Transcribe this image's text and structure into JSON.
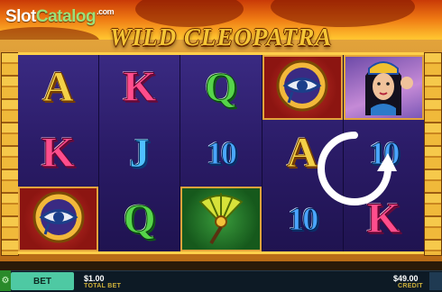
{
  "watermark": {
    "part1": "Slot",
    "part2": "Catalog",
    "suffix": ".com"
  },
  "game": {
    "title": "WILD CLEOPATRA"
  },
  "reels": [
    {
      "symbols": [
        {
          "kind": "letter",
          "text": "A",
          "style": "A"
        },
        {
          "kind": "letter",
          "text": "K",
          "style": "K"
        },
        {
          "kind": "icon",
          "icon": "eye-of-horus-icon",
          "tile": "red"
        }
      ]
    },
    {
      "symbols": [
        {
          "kind": "letter",
          "text": "K",
          "style": "K"
        },
        {
          "kind": "letter",
          "text": "J",
          "style": "J"
        },
        {
          "kind": "letter",
          "text": "Q",
          "style": "Q"
        }
      ]
    },
    {
      "symbols": [
        {
          "kind": "letter",
          "text": "Q",
          "style": "Q"
        },
        {
          "kind": "letter",
          "text": "10",
          "style": "10"
        },
        {
          "kind": "icon",
          "icon": "palm-fan-icon",
          "tile": "green"
        }
      ]
    },
    {
      "symbols": [
        {
          "kind": "icon",
          "icon": "eye-of-horus-icon",
          "tile": "red"
        },
        {
          "kind": "letter",
          "text": "A",
          "style": "A"
        },
        {
          "kind": "letter",
          "text": "10",
          "style": "10"
        }
      ]
    },
    {
      "symbols": [
        {
          "kind": "icon",
          "icon": "cleopatra-portrait-icon",
          "tile": "purple"
        },
        {
          "kind": "letter",
          "text": "10",
          "style": "10"
        },
        {
          "kind": "letter",
          "text": "K",
          "style": "K"
        }
      ]
    }
  ],
  "controls": {
    "settings_icon": "gear-icon",
    "bet_label": "BET",
    "spin_icon": "spin-arrow-icon",
    "total_bet_value": "$1.00",
    "total_bet_label": "TOTAL BET",
    "credit_value": "$49.00",
    "credit_label": "CREDIT"
  },
  "colors": {
    "reel_bg": "#2a1b66",
    "frame_gold": "#e2a33b",
    "bet_button": "#4ec9a3",
    "bar_bg": "#0d1a25"
  }
}
